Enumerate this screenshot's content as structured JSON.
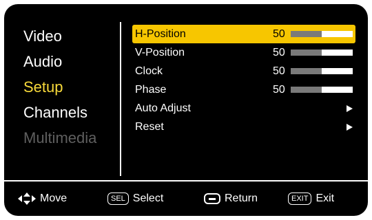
{
  "sidebar": {
    "items": [
      {
        "label": "Video"
      },
      {
        "label": "Audio"
      },
      {
        "label": "Setup"
      },
      {
        "label": "Channels"
      },
      {
        "label": "Multimedia"
      }
    ],
    "active": "Setup",
    "disabled": "Multimedia"
  },
  "menu": {
    "rows": [
      {
        "label": "H-Position",
        "value": "50",
        "level": 0.5
      },
      {
        "label": "V-Position",
        "value": "50",
        "level": 0.5
      },
      {
        "label": "Clock",
        "value": "50",
        "level": 0.5
      },
      {
        "label": "Phase",
        "value": "50",
        "level": 0.5
      },
      {
        "label": "Auto Adjust",
        "icon": "right-triangle-icon"
      },
      {
        "label": "Reset",
        "icon": "right-triangle-icon"
      }
    ],
    "selected": "H-Position"
  },
  "footer": {
    "move": {
      "label": "Move",
      "icon": "four-way-arrow-icon"
    },
    "select": {
      "key": "SEL",
      "label": "Select"
    },
    "return": {
      "label": "Return",
      "icon": "minus-box-icon"
    },
    "exit": {
      "key": "EXIT",
      "label": "Exit"
    }
  },
  "colors": {
    "background": "#000000",
    "highlight": "#f7c600",
    "active_text": "#f7d93a",
    "disabled_text": "#5f5f5f",
    "bar_fill": "#7a7a7a"
  }
}
